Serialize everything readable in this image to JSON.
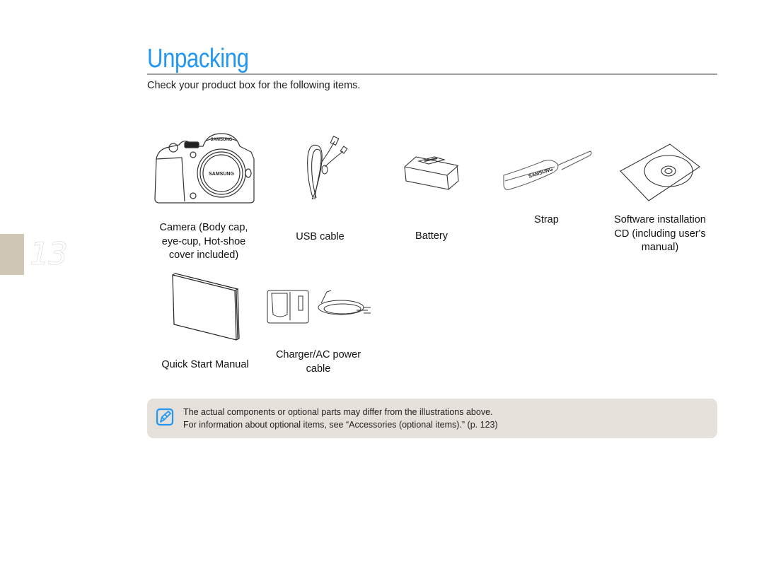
{
  "page": {
    "number": "13",
    "title": "Unpacking",
    "intro": "Check your product box for the following items."
  },
  "items": [
    {
      "name": "camera",
      "label_lines": [
        "Camera (Body cap,",
        "eye-cup, Hot-shoe",
        "cover included)"
      ],
      "brand_text": "SAMSUNG"
    },
    {
      "name": "usb-cable",
      "label_lines": [
        "USB cable"
      ]
    },
    {
      "name": "battery",
      "label_lines": [
        "Battery"
      ]
    },
    {
      "name": "strap",
      "label_lines": [
        "Strap"
      ],
      "brand_text": "SAMSUNG"
    },
    {
      "name": "software-cd",
      "label_lines": [
        "Software installation",
        "CD (including user's",
        "manual)"
      ]
    },
    {
      "name": "quick-start-manual",
      "label_lines": [
        "Quick Start Manual"
      ]
    },
    {
      "name": "charger-ac-cable",
      "label_lines": [
        "Charger/AC power",
        "cable"
      ]
    }
  ],
  "note": {
    "icon": "note-pencil-icon",
    "lines": [
      "The actual components or optional parts may differ from the illustrations above.",
      "For information about optional items, see “Accessories (optional items).”  (p. 123)"
    ]
  },
  "colors": {
    "title": "#2196f3",
    "rule": "#9e9e9e",
    "page_tab": "#cfc6b6",
    "note_bg": "#e5e0da",
    "note_icon": "#2196f3"
  }
}
